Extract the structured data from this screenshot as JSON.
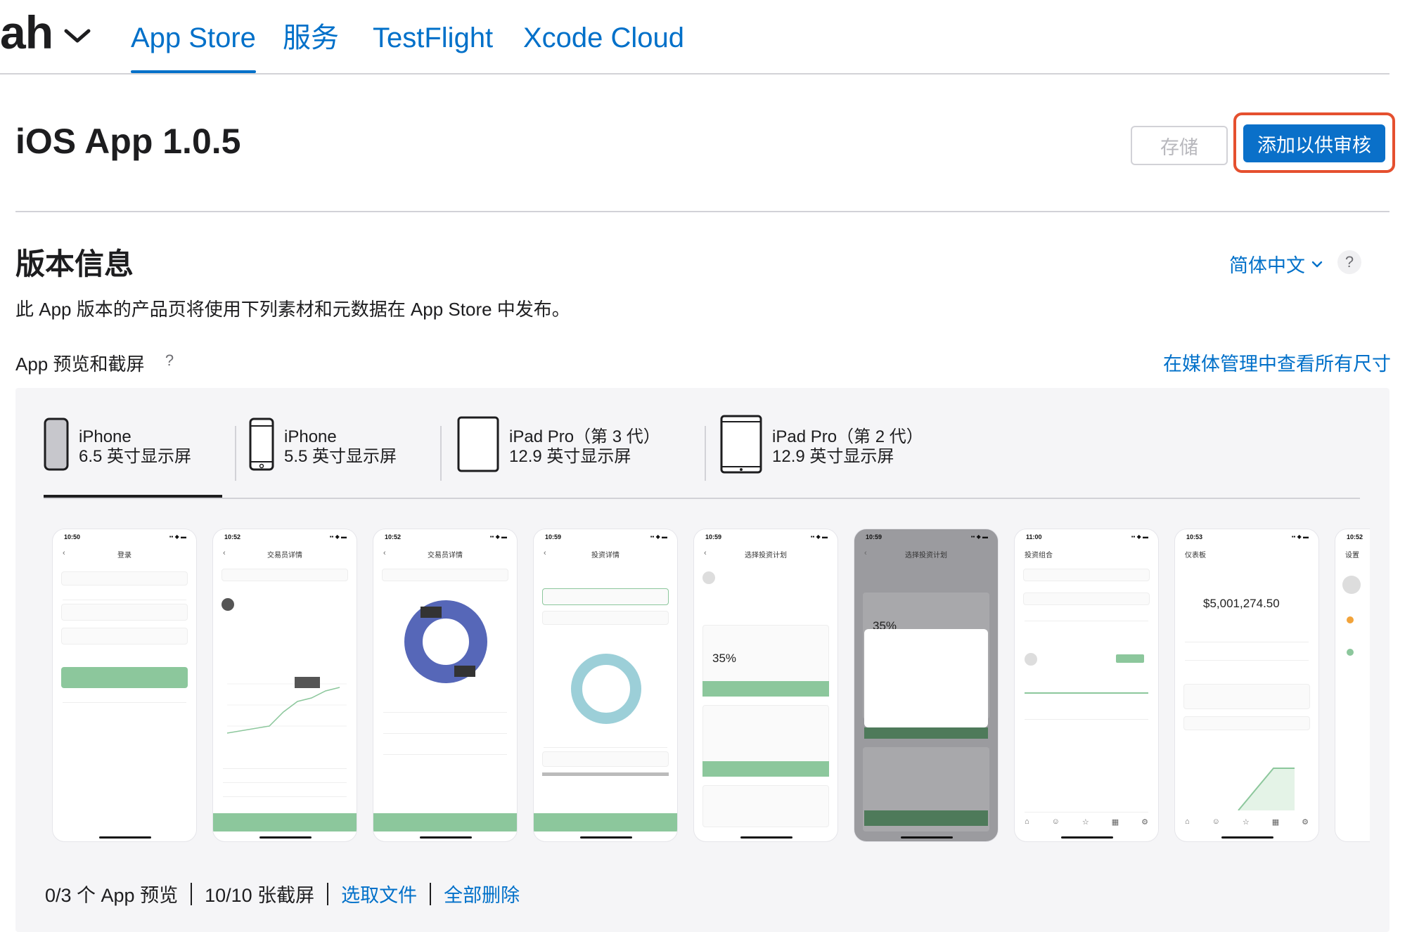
{
  "nav": {
    "app_name": "ah",
    "tabs": [
      {
        "label": "App Store",
        "active": true
      },
      {
        "label": "服务"
      },
      {
        "label": "TestFlight"
      },
      {
        "label": "Xcode Cloud"
      }
    ]
  },
  "header": {
    "title": "iOS App 1.0.5",
    "save_label": "存储",
    "submit_label": "添加以供审核"
  },
  "version_info": {
    "title": "版本信息",
    "language": "简体中文",
    "help": "?",
    "description": "此 App 版本的产品页将使用下列素材和元数据在 App Store 中发布。"
  },
  "media": {
    "title": "App 预览和截屏",
    "help": "?",
    "view_all_link": "在媒体管理中查看所有尺寸",
    "device_tabs": [
      {
        "line1": "iPhone",
        "line2": "6.5 英寸显示屏",
        "active": true
      },
      {
        "line1": "iPhone",
        "line2": "5.5 英寸显示屏"
      },
      {
        "line1": "iPad Pro（第 3 代）",
        "line2": "12.9 英寸显示屏"
      },
      {
        "line1": "iPad Pro（第 2 代）",
        "line2": "12.9 英寸显示屏"
      }
    ],
    "screenshots": [
      {
        "time": "10:50",
        "title": "登录",
        "big": ""
      },
      {
        "time": "10:52",
        "title": "交易员详情",
        "big": ""
      },
      {
        "time": "10:52",
        "title": "交易员详情",
        "big": ""
      },
      {
        "time": "10:59",
        "title": "投资详情",
        "big": ""
      },
      {
        "time": "10:59",
        "title": "选择投资计划",
        "big": "35%"
      },
      {
        "time": "10:59",
        "title": "选择投资计划",
        "big": "35%"
      },
      {
        "time": "11:00",
        "title": "投资组合",
        "big": ""
      },
      {
        "time": "10:53",
        "title": "仪表板",
        "big": "$5,001,274.50"
      },
      {
        "time": "10:52",
        "title": "设置",
        "big": ""
      }
    ],
    "footer": {
      "previews": "0/3 个 App 预览",
      "screenshots": "10/10 张截屏",
      "choose_file": "选取文件",
      "delete_all": "全部删除"
    }
  },
  "colors": {
    "accent": "#0070c9",
    "highlight": "#e5502f",
    "app_green": "#8cc79c",
    "panel_bg": "#f5f5f7"
  }
}
